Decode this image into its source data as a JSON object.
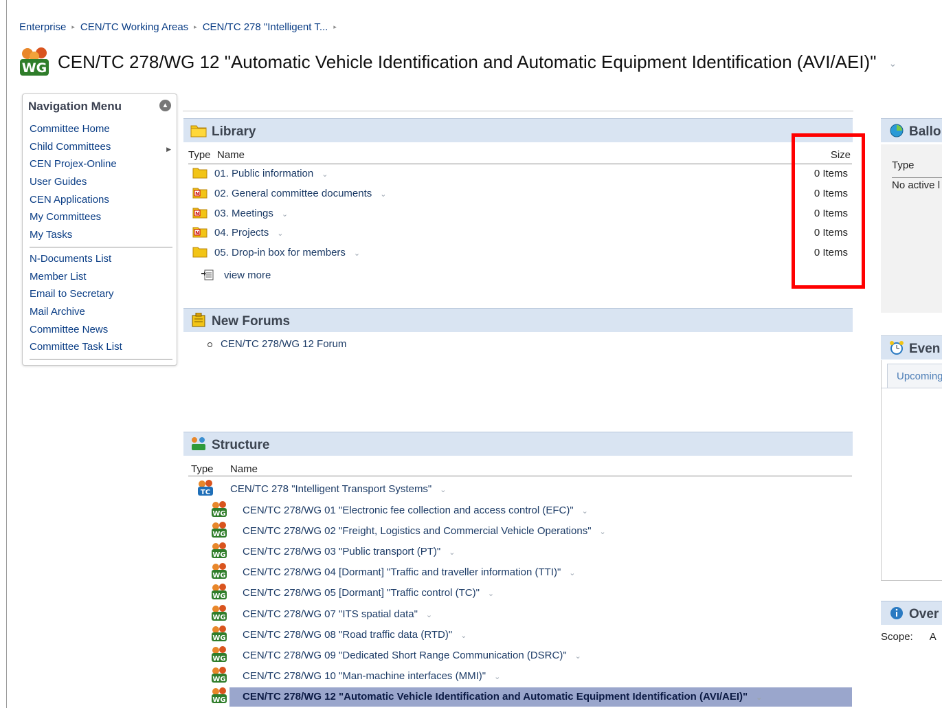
{
  "breadcrumb": [
    "Enterprise",
    "CEN/TC Working Areas",
    "CEN/TC 278 \"Intelligent T..."
  ],
  "page_title": "CEN/TC 278/WG 12 \"Automatic Vehicle Identification and Automatic Equipment Identification (AVI/AEI)\"",
  "nav": {
    "title": "Navigation Menu",
    "group1": [
      "Committee Home",
      "Child Committees",
      "CEN Projex-Online",
      "User Guides",
      "CEN Applications",
      "My Committees",
      "My Tasks"
    ],
    "group2": [
      "N-Documents List",
      "Member List",
      "Email to Secretary",
      "Mail Archive",
      "Committee News",
      "Committee Task List"
    ]
  },
  "library": {
    "title": "Library",
    "col_type": "Type",
    "col_name": "Name",
    "col_size": "Size",
    "rows": [
      {
        "name": "01. Public information",
        "size": "0 Items",
        "icon": "folder-icon"
      },
      {
        "name": "02. General committee documents",
        "size": "0 Items",
        "icon": "n-folder-icon"
      },
      {
        "name": "03. Meetings",
        "size": "0 Items",
        "icon": "n-folder-icon"
      },
      {
        "name": "04. Projects",
        "size": "0 Items",
        "icon": "n-folder-icon"
      },
      {
        "name": "05. Drop-in box for members",
        "size": "0 Items",
        "icon": "folder-icon"
      }
    ],
    "view_more": "view more"
  },
  "forums": {
    "title": "New Forums",
    "items": [
      "CEN/TC 278/WG 12 Forum"
    ]
  },
  "structure": {
    "title": "Structure",
    "col_type": "Type",
    "col_name": "Name",
    "parent": "CEN/TC 278 \"Intelligent Transport Systems\"",
    "children": [
      "CEN/TC 278/WG 01 \"Electronic fee collection and access control (EFC)\"",
      "CEN/TC 278/WG 02 \"Freight, Logistics and Commercial Vehicle Operations\"",
      "CEN/TC 278/WG 03 \"Public transport (PT)\"",
      "CEN/TC 278/WG 04 [Dormant] \"Traffic and traveller information (TTI)\"",
      "CEN/TC 278/WG 05 [Dormant] \"Traffic control (TC)\"",
      "CEN/TC 278/WG 07 \"ITS spatial data\"",
      "CEN/TC 278/WG 08 \"Road traffic data (RTD)\"",
      "CEN/TC 278/WG 09 \"Dedicated Short Range Communication (DSRC)\"",
      "CEN/TC 278/WG 10 \"Man-machine interfaces (MMI)\"",
      "CEN/TC 278/WG 12 \"Automatic Vehicle Identification and Automatic Equipment Identification (AVI/AEI)\""
    ],
    "active_index": 9
  },
  "right": {
    "ballots_title": "Ballo",
    "ballots_type": "Type",
    "ballots_empty": "No active l",
    "events_title": "Even",
    "events_tab": "Upcoming",
    "overview_title": "Over",
    "scope_label": "Scope:",
    "scope_value": "A"
  },
  "colors": {
    "link": "#1c3b66",
    "section_header_bg": "#d9e4f2",
    "highlight_row": "#9aa6cc",
    "annotation_box": "#ff0000"
  }
}
